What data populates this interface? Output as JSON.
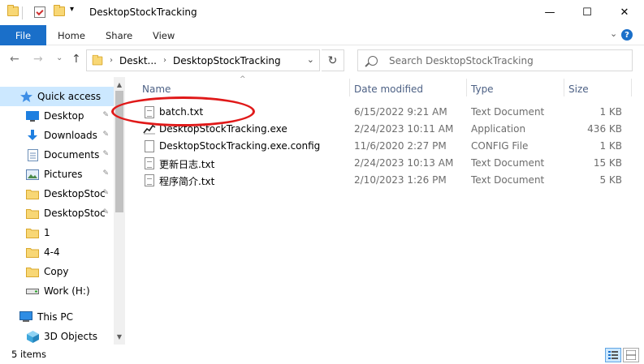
{
  "window": {
    "title": "DesktopStockTracking",
    "minimize_glyph": "—",
    "maximize_glyph": "☐",
    "close_glyph": "✕"
  },
  "quick_access": {
    "dropdown_glyph": "▾"
  },
  "ribbon": {
    "tabs": [
      "File",
      "Home",
      "Share",
      "View"
    ],
    "expand_glyph": "⌄",
    "help_glyph": "?"
  },
  "address": {
    "crumbs": [
      "Deskt...",
      "DesktopStockTracking"
    ],
    "separator": "›",
    "refresh_glyph": "↻",
    "dropdown_glyph": "⌄"
  },
  "nav_buttons": {
    "back": "←",
    "forward": "→",
    "recent": "⌄",
    "up": "↑"
  },
  "search": {
    "placeholder": "Search DesktopStockTracking"
  },
  "sidebar": {
    "items": [
      {
        "label": "Quick access",
        "icon": "star-icon",
        "pinned": false
      },
      {
        "label": "Desktop",
        "icon": "desktop-icon",
        "pinned": true
      },
      {
        "label": "Downloads",
        "icon": "download-icon",
        "pinned": true
      },
      {
        "label": "Documents",
        "icon": "documents-icon",
        "pinned": true
      },
      {
        "label": "Pictures",
        "icon": "pictures-icon",
        "pinned": true
      },
      {
        "label": "DesktopStoc",
        "icon": "folder-icon",
        "pinned": true
      },
      {
        "label": "DesktopStoc",
        "icon": "folder-icon",
        "pinned": true
      },
      {
        "label": "1",
        "icon": "folder-icon",
        "pinned": false
      },
      {
        "label": "4-4",
        "icon": "folder-icon",
        "pinned": false
      },
      {
        "label": "Copy",
        "icon": "folder-icon",
        "pinned": false
      },
      {
        "label": "Work (H:)",
        "icon": "drive-icon",
        "pinned": false
      },
      {
        "label": "This PC",
        "icon": "computer-icon",
        "pinned": false
      },
      {
        "label": "3D Objects",
        "icon": "cube-icon",
        "pinned": false
      }
    ],
    "pin_glyph": "📌",
    "scroll_up": "▲",
    "scroll_down": "▼"
  },
  "columns": {
    "name": "Name",
    "date": "Date modified",
    "type": "Type",
    "size": "Size",
    "sort_glyph": "^"
  },
  "files": [
    {
      "name": "batch.txt",
      "date": "6/15/2022 9:21 AM",
      "type": "Text Document",
      "size": "1 KB",
      "icon": "text-file-icon"
    },
    {
      "name": "DesktopStockTracking.exe",
      "date": "2/24/2023 10:11 AM",
      "type": "Application",
      "size": "436 KB",
      "icon": "chart-app-icon"
    },
    {
      "name": "DesktopStockTracking.exe.config",
      "date": "11/6/2020 2:27 PM",
      "type": "CONFIG File",
      "size": "1 KB",
      "icon": "blank-file-icon"
    },
    {
      "name": "更新日志.txt",
      "date": "2/24/2023 10:13 AM",
      "type": "Text Document",
      "size": "15 KB",
      "icon": "text-file-icon"
    },
    {
      "name": "程序简介.txt",
      "date": "2/10/2023 1:26 PM",
      "type": "Text Document",
      "size": "5 KB",
      "icon": "text-file-icon"
    }
  ],
  "status": {
    "item_count": "5 items"
  },
  "colors": {
    "accent": "#1a6fc9",
    "selection": "#cce8ff",
    "annotation": "#e01919"
  }
}
